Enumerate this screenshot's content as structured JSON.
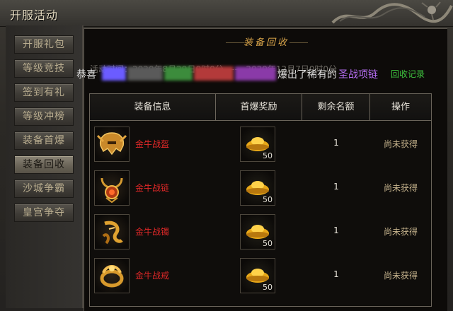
{
  "window": {
    "title": "开服活动"
  },
  "sidebar": {
    "items": [
      {
        "label": "开服礼包",
        "active": false
      },
      {
        "label": "等级竞技",
        "active": false
      },
      {
        "label": "签到有礼",
        "active": false
      },
      {
        "label": "等级冲榜",
        "active": false
      },
      {
        "label": "装备首爆",
        "active": false
      },
      {
        "label": "装备回收",
        "active": true
      },
      {
        "label": "沙城争霸",
        "active": false
      },
      {
        "label": "皇宫争夺",
        "active": false
      }
    ]
  },
  "main": {
    "title": "装备回收",
    "activity_time": "活动时间：2020年8月29日0时0分 —— 2020年12月7日0时0分",
    "announcement": {
      "prefix": "恭喜",
      "middle": "爆出了稀有的",
      "item": "圣战项链"
    },
    "record_link": "回收记录",
    "table": {
      "headers": [
        "装备信息",
        "首爆奖励",
        "剩余名额",
        "操作"
      ],
      "rows": [
        {
          "name": "金牛战盔",
          "reward_count": "50",
          "remain": "1",
          "status": "尚未获得"
        },
        {
          "name": "金牛战链",
          "reward_count": "50",
          "remain": "1",
          "status": "尚未获得"
        },
        {
          "name": "金牛战镯",
          "reward_count": "50",
          "remain": "1",
          "status": "尚未获得"
        },
        {
          "name": "金牛战戒",
          "reward_count": "50",
          "remain": "1",
          "status": "尚未获得"
        }
      ]
    }
  },
  "colors": {
    "item_name": "#e02828",
    "status": "#c9b68f",
    "record_link": "#3fc43f",
    "highlight_item": "#b46cf0",
    "title_gold": "#d9a54a"
  },
  "icons": {
    "rows": [
      "helmet-icon",
      "necklace-icon",
      "bracelet-icon",
      "ring-icon"
    ],
    "reward": "gold-ingot-icon"
  }
}
